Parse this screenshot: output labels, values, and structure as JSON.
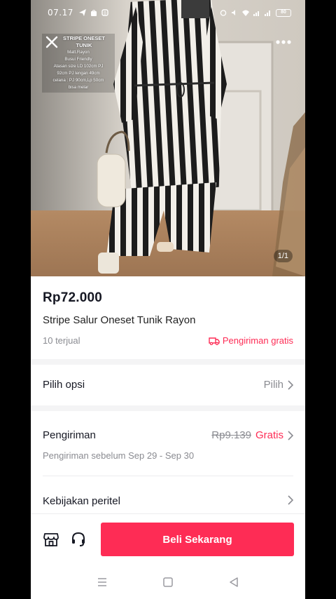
{
  "status_bar": {
    "time": "07.17",
    "battery": "80"
  },
  "image": {
    "caption_title": "STRIPE ONESET TUNIK",
    "caption_lines": [
      "Matt.Rayon",
      "Busui Friendly",
      "Atasan size LD 102cm PJ",
      "92cm PJ lengan 49cm",
      "celana : PJ 90cm,Lp 50cm",
      "bisa melar"
    ],
    "counter": "1/1"
  },
  "product": {
    "price": "Rp72.000",
    "name": "Stripe Salur Oneset Tunik Rayon",
    "sold": "10 terjual",
    "free_shipping": "Pengiriman gratis"
  },
  "options": {
    "label": "Pilih opsi",
    "value": "Pilih"
  },
  "shipping": {
    "label": "Pengiriman",
    "original_price": "Rp9.139",
    "price": "Gratis",
    "estimate": "Pengiriman sebelum Sep 29 - Sep 30"
  },
  "policy": {
    "label": "Kebijakan peritel"
  },
  "actions": {
    "buy_label": "Beli Sekarang"
  },
  "colors": {
    "accent": "#fe2c55",
    "text": "#161823",
    "muted": "#8a8b91"
  }
}
